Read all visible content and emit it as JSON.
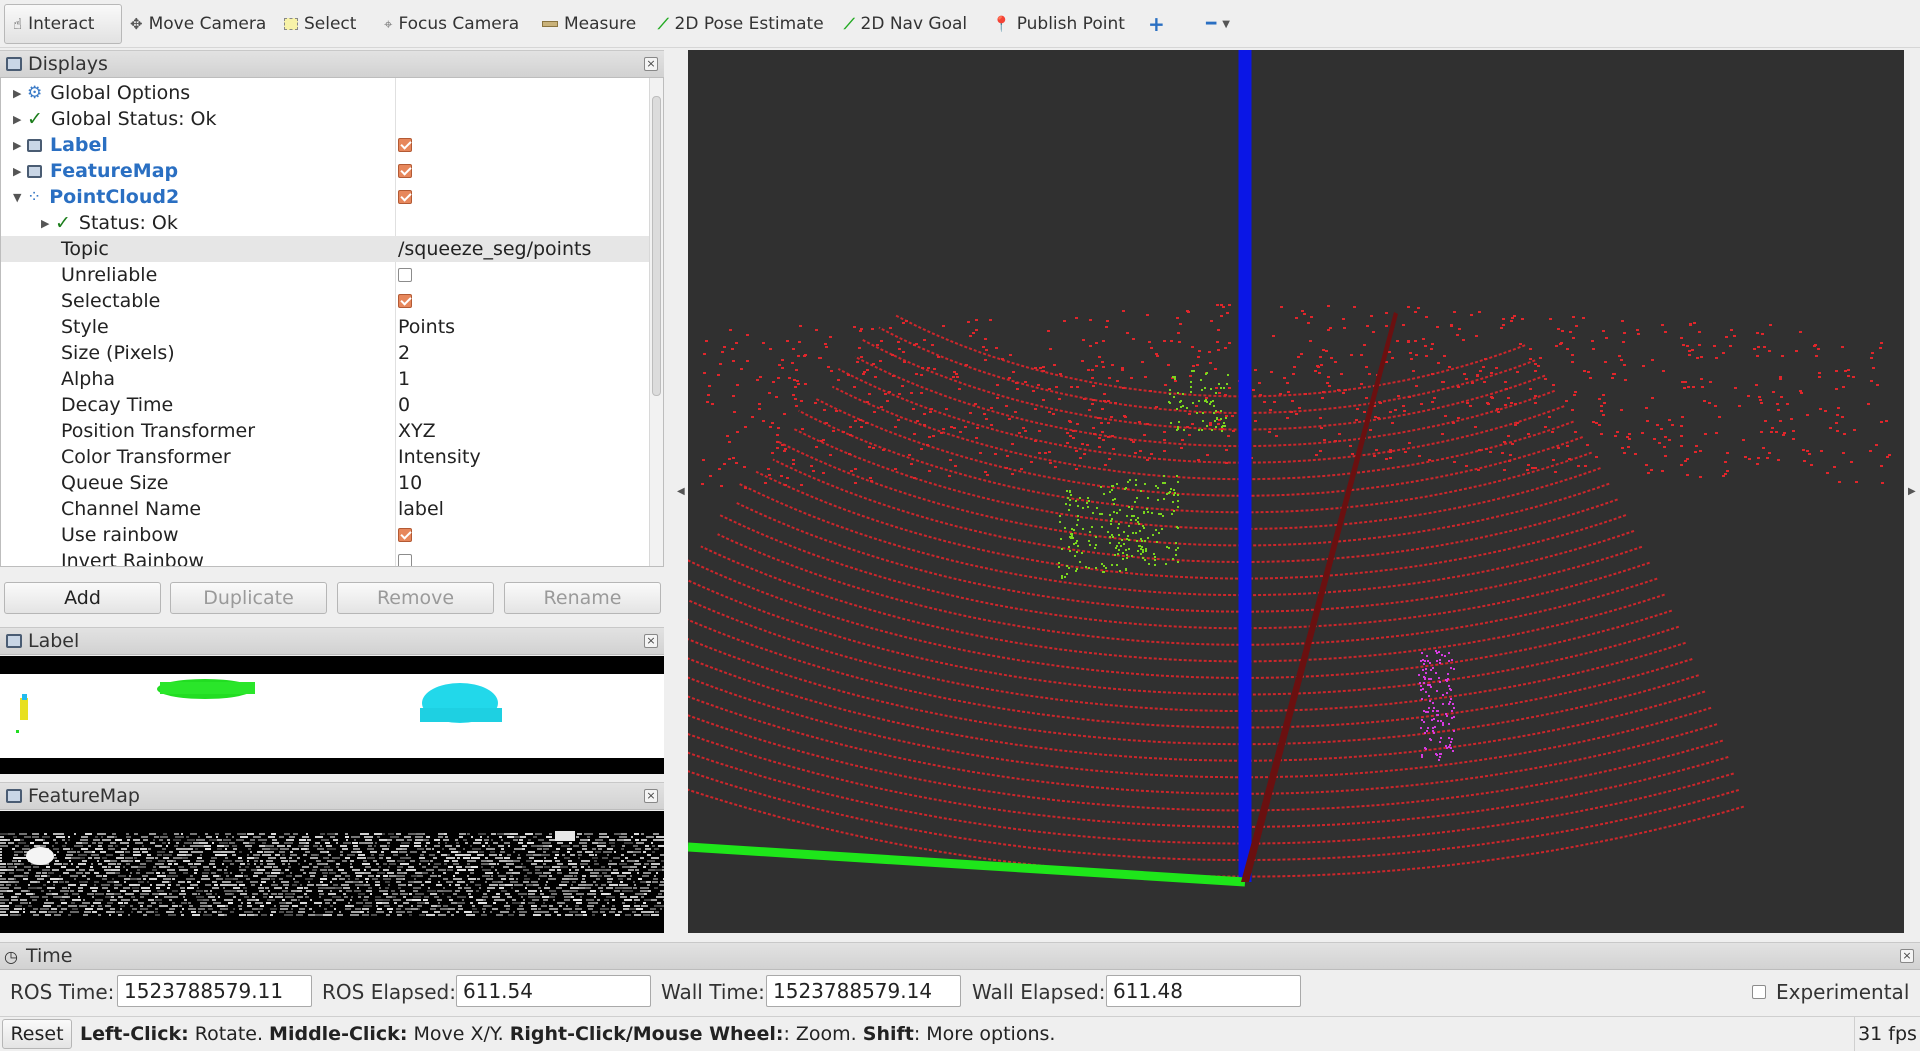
{
  "toolbar": {
    "interact": "Interact",
    "move_camera": "Move Camera",
    "select": "Select",
    "focus_camera": "Focus Camera",
    "measure": "Measure",
    "pose_estimate": "2D Pose Estimate",
    "nav_goal": "2D Nav Goal",
    "publish_point": "Publish Point"
  },
  "displays": {
    "title": "Displays",
    "items": [
      {
        "label": "Global Options",
        "value": ""
      },
      {
        "label": "Global Status: Ok",
        "value": ""
      },
      {
        "label": "Label",
        "value": ""
      },
      {
        "label": "FeatureMap",
        "value": ""
      },
      {
        "label": "PointCloud2",
        "value": ""
      },
      {
        "label": "Status: Ok",
        "value": ""
      },
      {
        "label": "Topic",
        "value": "/squeeze_seg/points"
      },
      {
        "label": "Unreliable",
        "value": ""
      },
      {
        "label": "Selectable",
        "value": ""
      },
      {
        "label": "Style",
        "value": "Points"
      },
      {
        "label": "Size (Pixels)",
        "value": "2"
      },
      {
        "label": "Alpha",
        "value": "1"
      },
      {
        "label": "Decay Time",
        "value": "0"
      },
      {
        "label": "Position Transformer",
        "value": "XYZ"
      },
      {
        "label": "Color Transformer",
        "value": "Intensity"
      },
      {
        "label": "Queue Size",
        "value": "10"
      },
      {
        "label": "Channel Name",
        "value": "label"
      },
      {
        "label": "Use rainbow",
        "value": ""
      },
      {
        "label": "Invert Rainbow",
        "value": ""
      }
    ],
    "buttons": {
      "add": "Add",
      "duplicate": "Duplicate",
      "remove": "Remove",
      "rename": "Rename"
    }
  },
  "label_panel": {
    "title": "Label"
  },
  "featuremap_panel": {
    "title": "FeatureMap"
  },
  "time": {
    "title": "Time",
    "ros_time_label": "ROS Time:",
    "ros_time": "1523788579.11",
    "ros_elapsed_label": "ROS Elapsed:",
    "ros_elapsed": "611.54",
    "wall_time_label": "Wall Time:",
    "wall_time": "1523788579.14",
    "wall_elapsed_label": "Wall Elapsed:",
    "wall_elapsed": "611.48",
    "experimental": "Experimental"
  },
  "status": {
    "reset": "Reset",
    "left_click": "Left-Click:",
    "left_desc": "Rotate.",
    "middle_click": "Middle-Click:",
    "middle_desc": "Move X/Y.",
    "right_click": "Right-Click/Mouse Wheel:",
    "right_desc": ": Zoom.",
    "shift": "Shift",
    "shift_desc": ": More options.",
    "fps": "31 fps"
  },
  "colors": {
    "viewport_bg": "#303030",
    "ground_points": "#e0262b",
    "car_points": "#7ad61e",
    "pedestrian_points": "#d63be0",
    "axis_z": "#0a16e6",
    "axis_y": "#1ee61a",
    "axis_x": "#6a1010"
  }
}
